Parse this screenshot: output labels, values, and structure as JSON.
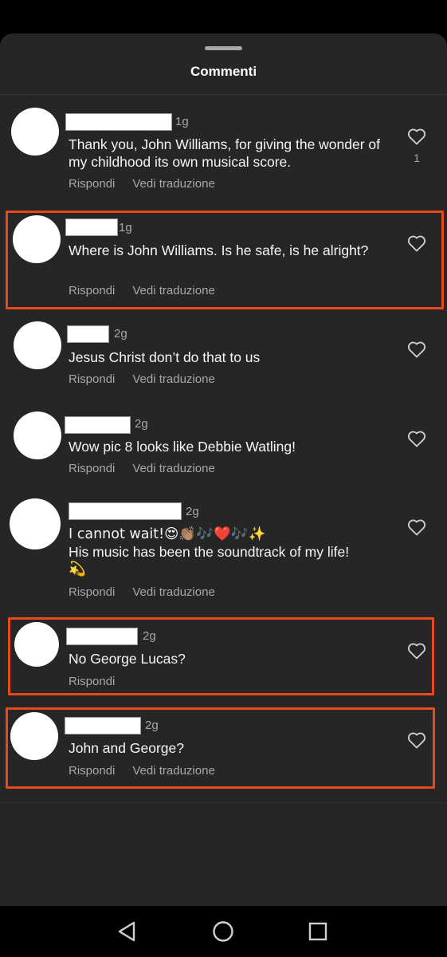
{
  "sheet": {
    "title": "Commenti"
  },
  "actions": {
    "reply": "Rispondi",
    "translate": "Vedi traduzione"
  },
  "comments": [
    {
      "time": "1g",
      "text": "Thank you, John Williams, for giving the wonder of my childhood its own musical score.",
      "likes": "1"
    },
    {
      "time": "1g",
      "text": "Where is John Williams. Is he safe, is he alright?",
      "likes": ""
    },
    {
      "time": "2g",
      "text": "Jesus Christ don’t do that to us",
      "likes": ""
    },
    {
      "time": "2g",
      "text": "Wow pic 8 looks like Debbie Watling!",
      "likes": ""
    },
    {
      "time": "2g",
      "text_line1": "I cannot wait!😍👏🏽🎶❤️🎶✨",
      "text_line2": "His music has been the soundtrack of my life!",
      "text_line3": "💫",
      "likes": ""
    },
    {
      "time": "2g",
      "text": "No George Lucas?",
      "likes": ""
    },
    {
      "time": "2g",
      "text": "John and George?",
      "likes": ""
    }
  ],
  "icons": {
    "like": "heart-outline-icon",
    "nav_back": "triangle-back-icon",
    "nav_home": "circle-home-icon",
    "nav_recents": "square-recents-icon"
  },
  "colors": {
    "highlight": "#e8481c",
    "sheet_bg": "#262626",
    "muted_text": "#a8a8a8"
  }
}
